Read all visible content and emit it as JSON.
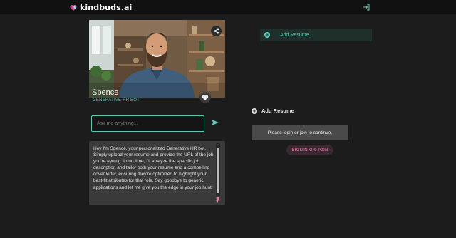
{
  "app": {
    "brand": "kindbuds.ai",
    "colors": {
      "accent": "#5fc7b6",
      "background": "#1c1c1c",
      "topbar": "#111111",
      "signin": "#c6678c"
    }
  },
  "header": {
    "login_icon": "login-arrow-icon"
  },
  "bot": {
    "name": "Spence",
    "role": "GENERATIVE HR BOT",
    "share_icon": "share-icon",
    "favorite_icon": "heart-icon"
  },
  "chat": {
    "placeholder": "Ask me anything...",
    "send_icon": "send-icon",
    "message": "Hey I'm Spence, your personalized Generative HR bot. Simply upload your resume and provide the URL of the job you're eyeing. In no time, I'll analyze the specific job description and tailor both your resume and a compelling cover letter, ensuring they're optimized to highlight your best-fit attributes for that role. Say goodbye to generic applications and let me give you the edge in your job hunt!"
  },
  "resume_panel": {
    "top_button": "Add Resume",
    "heading": "Add Resume",
    "login_message": "Please login or join to continue.",
    "signin_button": "SIGNIN OR JOIN"
  }
}
